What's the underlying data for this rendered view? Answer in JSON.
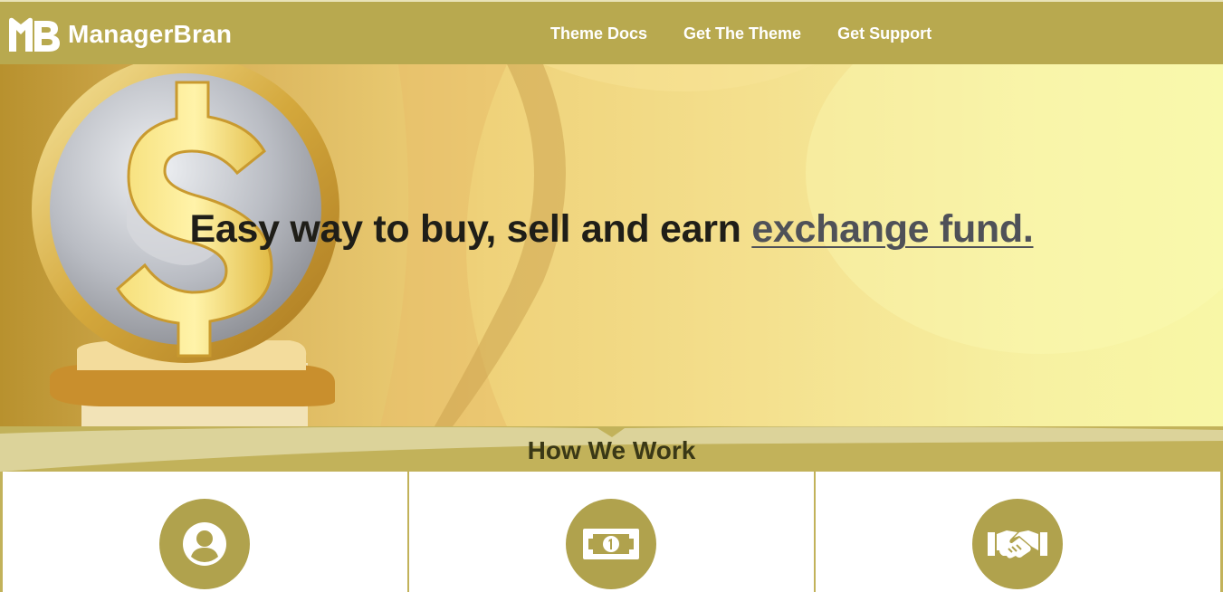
{
  "header": {
    "brand_name": "ManagerBran",
    "logo_icon": "mb-monogram-logo",
    "nav": [
      {
        "label": "Theme Docs"
      },
      {
        "label": "Get The Theme"
      },
      {
        "label": "Get Support"
      }
    ]
  },
  "hero": {
    "title_main": "Easy way to buy, sell and earn ",
    "title_accent": "exchange fund.",
    "art_icon": "gold-dollar-coin-illustration"
  },
  "how": {
    "title": "How We Work",
    "cards": [
      {
        "icon": "user-account-icon"
      },
      {
        "icon": "money-bill-icon"
      },
      {
        "icon": "handshake-icon"
      }
    ]
  },
  "colors": {
    "header_bg": "#b8a94f",
    "section_bg": "#c2b25a",
    "circle_bg": "#b0a24d",
    "accent_text": "#4f5158"
  }
}
